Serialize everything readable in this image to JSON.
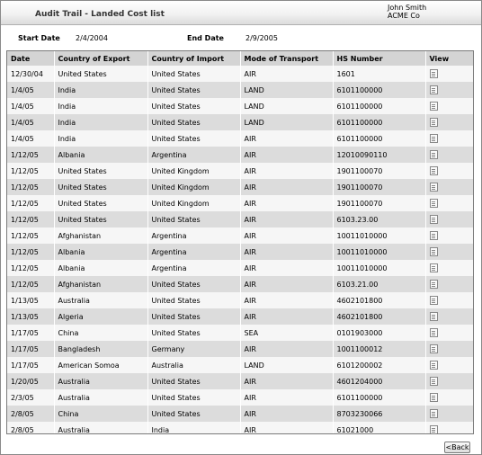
{
  "header": {
    "title": "Audit Trail - Landed Cost list",
    "user_name": "John Smith",
    "company": "ACME Co"
  },
  "filters": {
    "start_label": "Start Date",
    "start_value": "2/4/2004",
    "end_label": "End Date",
    "end_value": "2/9/2005"
  },
  "table": {
    "columns": [
      "Date",
      "Country of Export",
      "Country of Import",
      "Mode of Transport",
      "HS Number",
      "View"
    ],
    "rows": [
      [
        "12/30/04",
        "United States",
        "United States",
        "AIR",
        "1601"
      ],
      [
        "1/4/05",
        "India",
        "United States",
        "LAND",
        "6101100000"
      ],
      [
        "1/4/05",
        "India",
        "United States",
        "LAND",
        "6101100000"
      ],
      [
        "1/4/05",
        "India",
        "United States",
        "LAND",
        "6101100000"
      ],
      [
        "1/4/05",
        "India",
        "United States",
        "AIR",
        "6101100000"
      ],
      [
        "1/12/05",
        "Albania",
        "Argentina",
        "AIR",
        "12010090110"
      ],
      [
        "1/12/05",
        "United States",
        "United Kingdom",
        "AIR",
        "1901100070"
      ],
      [
        "1/12/05",
        "United States",
        "United Kingdom",
        "AIR",
        "1901100070"
      ],
      [
        "1/12/05",
        "United States",
        "United Kingdom",
        "AIR",
        "1901100070"
      ],
      [
        "1/12/05",
        "United States",
        "United States",
        "AIR",
        "6103.23.00"
      ],
      [
        "1/12/05",
        "Afghanistan",
        "Argentina",
        "AIR",
        "10011010000"
      ],
      [
        "1/12/05",
        "Albania",
        "Argentina",
        "AIR",
        "10011010000"
      ],
      [
        "1/12/05",
        "Albania",
        "Argentina",
        "AIR",
        "10011010000"
      ],
      [
        "1/12/05",
        "Afghanistan",
        "United States",
        "AIR",
        "6103.21.00"
      ],
      [
        "1/13/05",
        "Australia",
        "United States",
        "AIR",
        "4602101800"
      ],
      [
        "1/13/05",
        "Algeria",
        "United States",
        "AIR",
        "4602101800"
      ],
      [
        "1/17/05",
        "China",
        "United States",
        "SEA",
        "0101903000"
      ],
      [
        "1/17/05",
        "Bangladesh",
        "Germany",
        "AIR",
        "1001100012"
      ],
      [
        "1/17/05",
        "American Somoa",
        "Australia",
        "LAND",
        "6101200002"
      ],
      [
        "1/20/05",
        "Australia",
        "United States",
        "AIR",
        "4601204000"
      ],
      [
        "2/3/05",
        "Australia",
        "United States",
        "AIR",
        "6101100000"
      ],
      [
        "2/8/05",
        "China",
        "United States",
        "AIR",
        "8703230066"
      ],
      [
        "2/8/05",
        "Australia",
        "India",
        "AIR",
        "61021000"
      ]
    ]
  },
  "icons": {
    "view": "document-icon"
  },
  "footer": {
    "back_label": "<Back"
  }
}
